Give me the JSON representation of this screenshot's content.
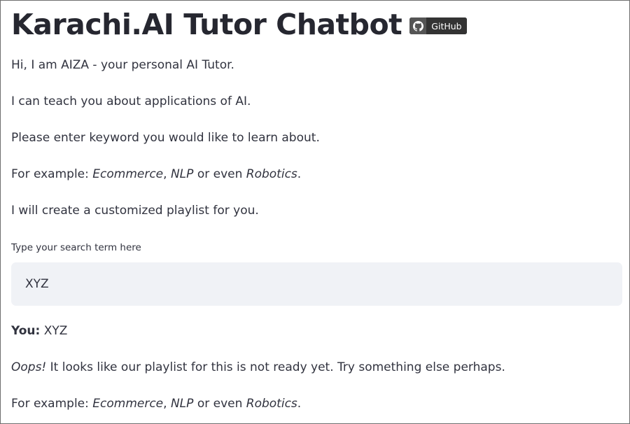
{
  "header": {
    "title": "Karachi.AI Tutor Chatbot",
    "github_badge_label": "GitHub"
  },
  "intro": {
    "line1": "Hi, I am AIZA - your personal AI Tutor.",
    "line2": "I can teach you about applications of AI.",
    "line3": "Please enter keyword you would like to learn about.",
    "example": {
      "prefix": "For example: ",
      "item1": "Ecommerce",
      "sep1": ", ",
      "item2": "NLP",
      "sep2": " or even ",
      "item3": "Robotics",
      "suffix": "."
    },
    "line5": "I will create a customized playlist for you."
  },
  "search": {
    "label": "Type your search term here",
    "value": "XYZ"
  },
  "chat": {
    "user_prefix": "You:",
    "user_message": " XYZ",
    "response_emphasis": "Oops!",
    "response_text": " It looks like our playlist for this is not ready yet. Try something else perhaps.",
    "example": {
      "prefix": "For example: ",
      "item1": "Ecommerce",
      "sep1": ", ",
      "item2": "NLP",
      "sep2": " or even ",
      "item3": "Robotics",
      "suffix": "."
    }
  },
  "colors": {
    "text": "#31333f",
    "input_background": "#f0f2f6",
    "badge_dark": "#333333",
    "badge_logo_bg": "#555555"
  },
  "icons": {
    "github": "github-icon"
  }
}
